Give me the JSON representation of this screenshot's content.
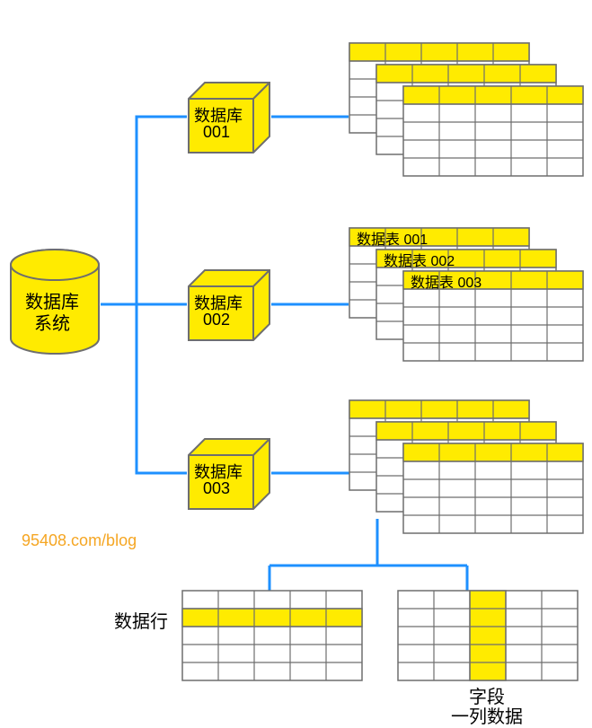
{
  "colors": {
    "yellow": "#FFEB00",
    "blue": "#1E90FF",
    "gray": "#6e6e6e",
    "black": "#000000",
    "orange": "#F5A623"
  },
  "root": {
    "label_line1": "数据库",
    "label_line2": "系统"
  },
  "databases": [
    {
      "label_line1": "数据库",
      "label_line2": "001"
    },
    {
      "label_line1": "数据库",
      "label_line2": "002"
    },
    {
      "label_line1": "数据库",
      "label_line2": "003"
    }
  ],
  "tables": {
    "group2": {
      "t1": "数据表 001",
      "t2": "数据表 002",
      "t3": "数据表 003"
    }
  },
  "row": {
    "label": "数据行"
  },
  "field": {
    "label_line1": "字段",
    "label_line2": "一列数据"
  },
  "watermark": "95408.com/blog"
}
